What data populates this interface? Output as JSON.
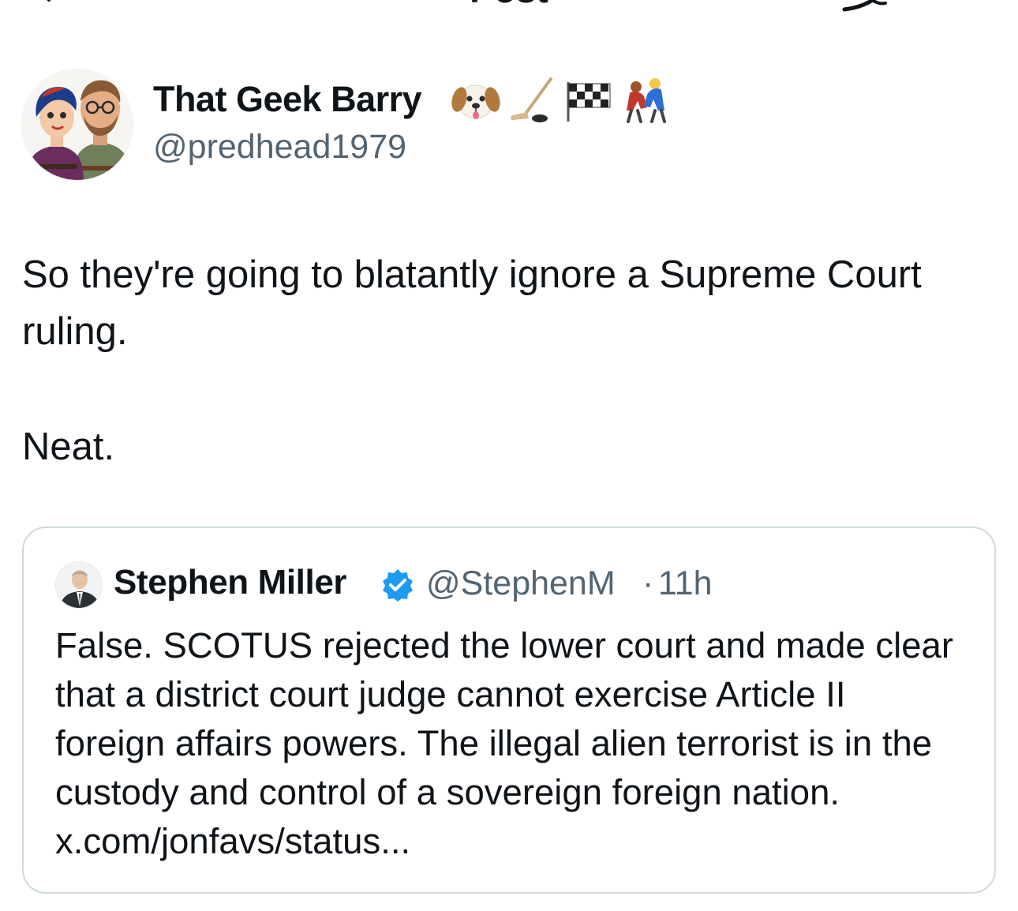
{
  "header": {
    "title": "Post",
    "back_icon": "arrow-left-icon",
    "grok_icon": "grok-icon"
  },
  "post": {
    "author": {
      "name": "That Geek Barry",
      "name_emojis": [
        "dog-face-emoji",
        "ice-hockey-emoji",
        "checkered-flag-emoji",
        "wrestlers-emoji"
      ],
      "handle": "@predhead1979",
      "avatar": "cartoon-couple-avatar"
    },
    "text_line1": "So they're going to blatantly ignore a Supreme Court ruling.",
    "text_line2": "Neat."
  },
  "quoted_post": {
    "author": {
      "name": "Stephen Miller",
      "verified": true,
      "verified_color": "#1d9bf0",
      "handle": "@StephenM",
      "separator": "·",
      "time": "11h",
      "avatar": "man-in-suit-avatar"
    },
    "text": "False. SCOTUS rejected the lower court and made clear that a district court judge cannot exercise Article II foreign affairs powers. The illegal alien terrorist is in the custody and control of a sovereign foreign nation. x.com/jonfavs/status..."
  },
  "colors": {
    "text_primary": "#0f1419",
    "text_secondary": "#536471",
    "border": "#cfd9de",
    "accent": "#1d9bf0"
  }
}
